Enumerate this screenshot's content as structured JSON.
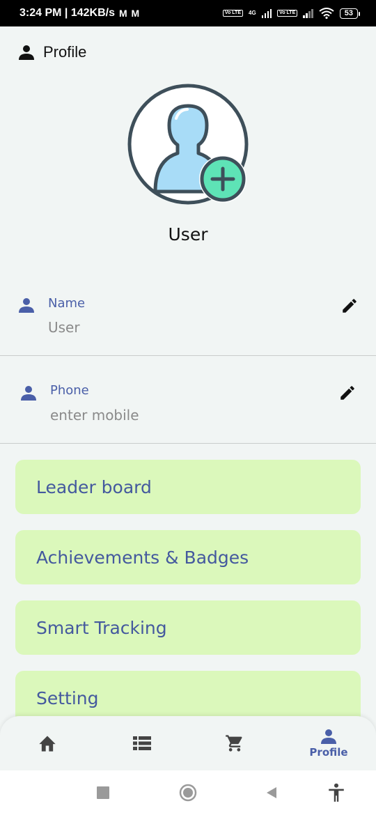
{
  "status_bar": {
    "time_speed": "3:24 PM | 142KB/s",
    "mail_icons": "M M",
    "volte_1": "Vo LTE",
    "network": "4G",
    "volte_2": "Vo LTE",
    "battery": "53"
  },
  "header": {
    "title": "Profile",
    "icon": "person-icon"
  },
  "profile": {
    "avatar_icon": "add-user-avatar-icon",
    "name": "User"
  },
  "fields": [
    {
      "label": "Name",
      "value": "User",
      "icon": "person-icon",
      "edit_icon": "pencil-icon"
    },
    {
      "label": "Phone",
      "value": "enter mobile",
      "icon": "person-icon",
      "edit_icon": "pencil-icon"
    }
  ],
  "menu": [
    {
      "label": "Leader board"
    },
    {
      "label": "Achievements & Badges"
    },
    {
      "label": "Smart Tracking"
    },
    {
      "label": "Setting"
    }
  ],
  "bottom_nav": [
    {
      "icon": "home-icon",
      "label": ""
    },
    {
      "icon": "list-icon",
      "label": ""
    },
    {
      "icon": "cart-icon",
      "label": ""
    },
    {
      "icon": "person-icon",
      "label": "Profile",
      "active": true
    }
  ],
  "colors": {
    "background": "#f1f5f4",
    "accent": "#4a5fa8",
    "card": "#dbf8bb",
    "avatar_plus": "#5ee3b6",
    "avatar_body": "#a8dcf7"
  }
}
